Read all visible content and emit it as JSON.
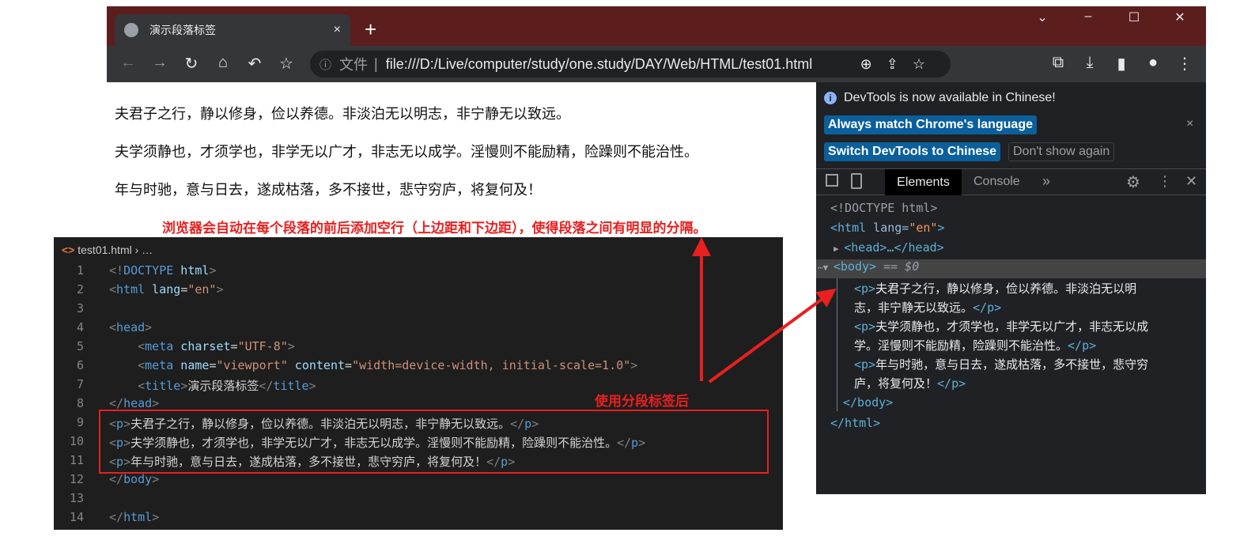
{
  "browser": {
    "tab_title": "演示段落标签",
    "tab_close": "×",
    "new_tab": "+",
    "window_controls": [
      "⌄",
      "–",
      "☐",
      "✕"
    ],
    "nav_icons": [
      "←",
      "→",
      "↻",
      "⌂",
      "↶",
      "☆"
    ],
    "omnibox": {
      "info": "ⓘ",
      "scheme_label": "文件",
      "separator": "|",
      "url": "file:///D:/Live/computer/study/one.study/DAY/Web/HTML/test01.html"
    },
    "right_icons": [
      "⊕",
      "⇪",
      "☆",
      "⧉",
      "⤓",
      "▮",
      "●",
      "⋮"
    ],
    "theme_color": "#5c1d1d"
  },
  "page": {
    "paragraphs": [
      "夫君子之行，静以修身，俭以养德。非淡泊无以明志，非宁静无以致远。",
      "夫学须静也，才须学也，非学无以广才，非志无以成学。淫慢则不能励精，险躁则不能治性。",
      "年与时驰，意与日去，遂成枯落，多不接世，悲守穷庐，将复何及！"
    ]
  },
  "devtools": {
    "banner": {
      "info_icon": "i",
      "message": "DevTools is now available in Chinese!",
      "btn_match": "Always match Chrome's language",
      "btn_switch": "Switch DevTools to Chinese",
      "btn_dont": "Don't show again",
      "close": "×"
    },
    "tabs": {
      "elements": "Elements",
      "console": "Console",
      "more": "»",
      "settings": "⚙",
      "menu": "⋮",
      "close": "✕"
    },
    "dom": {
      "doctype": "<!DOCTYPE html>",
      "html_open": "<html",
      "lang_attr": " lang=",
      "lang_val": "\"en\"",
      "gt": ">",
      "head": "<head>…</head>",
      "body": "<body>",
      "body_sel": " == $0",
      "p_open": "<p>",
      "p_close": "</p>",
      "p1a": "夫君子之行，静以修身，俭以养德。非淡泊无以明",
      "p1b": "志，非宁静无以致远。",
      "p2a": "夫学须静也，才须学也，非学无以广才，非志无以成",
      "p2b": "学。淫慢则不能励精，险躁则不能治性。",
      "p3a": "年与时驰，意与日去，遂成枯落，多不接世，悲守穷",
      "p3b": "庐，将复何及！",
      "body_close": "</body>",
      "html_close": "</html>"
    }
  },
  "editor": {
    "breadcrumb_file": "test01.html",
    "breadcrumb_rest": "› …",
    "lines": [
      {
        "n": "1",
        "tokens": [
          [
            "<!",
            "punc"
          ],
          [
            "DOCTYPE",
            "tag"
          ],
          [
            " html",
            "attr"
          ],
          [
            ">",
            "punc"
          ]
        ]
      },
      {
        "n": "2",
        "tokens": [
          [
            "<",
            "punc"
          ],
          [
            "html",
            "tag"
          ],
          [
            " lang",
            "attr"
          ],
          [
            "=",
            "text"
          ],
          [
            "\"en\"",
            "str"
          ],
          [
            ">",
            "punc"
          ]
        ]
      },
      {
        "n": "3",
        "tokens": []
      },
      {
        "n": "4",
        "tokens": [
          [
            "<",
            "punc"
          ],
          [
            "head",
            "tag"
          ],
          [
            ">",
            "punc"
          ]
        ]
      },
      {
        "n": "5",
        "tokens": [
          [
            "    <",
            "punc"
          ],
          [
            "meta",
            "tag"
          ],
          [
            " charset",
            "attr"
          ],
          [
            "=",
            "text"
          ],
          [
            "\"UTF-8\"",
            "str"
          ],
          [
            ">",
            "punc"
          ]
        ]
      },
      {
        "n": "6",
        "tokens": [
          [
            "    <",
            "punc"
          ],
          [
            "meta",
            "tag"
          ],
          [
            " name",
            "attr"
          ],
          [
            "=",
            "text"
          ],
          [
            "\"viewport\"",
            "str"
          ],
          [
            " content",
            "attr"
          ],
          [
            "=",
            "text"
          ],
          [
            "\"width=device-width, initial-scale=1.0\"",
            "str"
          ],
          [
            ">",
            "punc"
          ]
        ]
      },
      {
        "n": "7",
        "tokens": [
          [
            "    <",
            "punc"
          ],
          [
            "title",
            "tag"
          ],
          [
            ">",
            "punc"
          ],
          [
            "演示段落标签",
            "text"
          ],
          [
            "</",
            "punc"
          ],
          [
            "title",
            "tag"
          ],
          [
            ">",
            "punc"
          ]
        ]
      },
      {
        "n": "8",
        "tokens": [
          [
            "</",
            "punc"
          ],
          [
            "head",
            "tag"
          ],
          [
            ">",
            "punc"
          ]
        ]
      },
      {
        "n": "9",
        "tokens": [
          [
            "<",
            "punc"
          ],
          [
            "p",
            "tag"
          ],
          [
            ">",
            "punc"
          ],
          [
            "夫君子之行，静以修身，俭以养德。非淡泊无以明志，非宁静无以致远。",
            "text"
          ],
          [
            "</",
            "punc"
          ],
          [
            "p",
            "tag"
          ],
          [
            ">",
            "punc"
          ]
        ]
      },
      {
        "n": "10",
        "tokens": [
          [
            "<",
            "punc"
          ],
          [
            "p",
            "tag"
          ],
          [
            ">",
            "punc"
          ],
          [
            "夫学须静也，才须学也，非学无以广才，非志无以成学。淫慢则不能励精，险躁则不能治性。",
            "text"
          ],
          [
            "</",
            "punc"
          ],
          [
            "p",
            "tag"
          ],
          [
            ">",
            "punc"
          ]
        ]
      },
      {
        "n": "11",
        "tokens": [
          [
            "<",
            "punc"
          ],
          [
            "p",
            "tag"
          ],
          [
            ">",
            "punc"
          ],
          [
            "年与时驰，意与日去，遂成枯落，多不接世，悲守穷庐，将复何及！",
            "text"
          ],
          [
            "</",
            "punc"
          ],
          [
            "p",
            "tag"
          ],
          [
            ">",
            "punc"
          ]
        ]
      },
      {
        "n": "12",
        "tokens": [
          [
            "</",
            "punc"
          ],
          [
            "body",
            "tag"
          ],
          [
            ">",
            "punc"
          ]
        ]
      },
      {
        "n": "13",
        "tokens": []
      },
      {
        "n": "14",
        "tokens": [
          [
            "</",
            "punc"
          ],
          [
            "html",
            "tag"
          ],
          [
            ">",
            "punc"
          ]
        ]
      }
    ]
  },
  "annotations": {
    "top_note": "浏览器会自动在每个段落的前后添加空行（上边距和下边距），使得段落之间有明显的分隔。",
    "box_label": "使用分段标签后",
    "color": "#e8201f"
  }
}
